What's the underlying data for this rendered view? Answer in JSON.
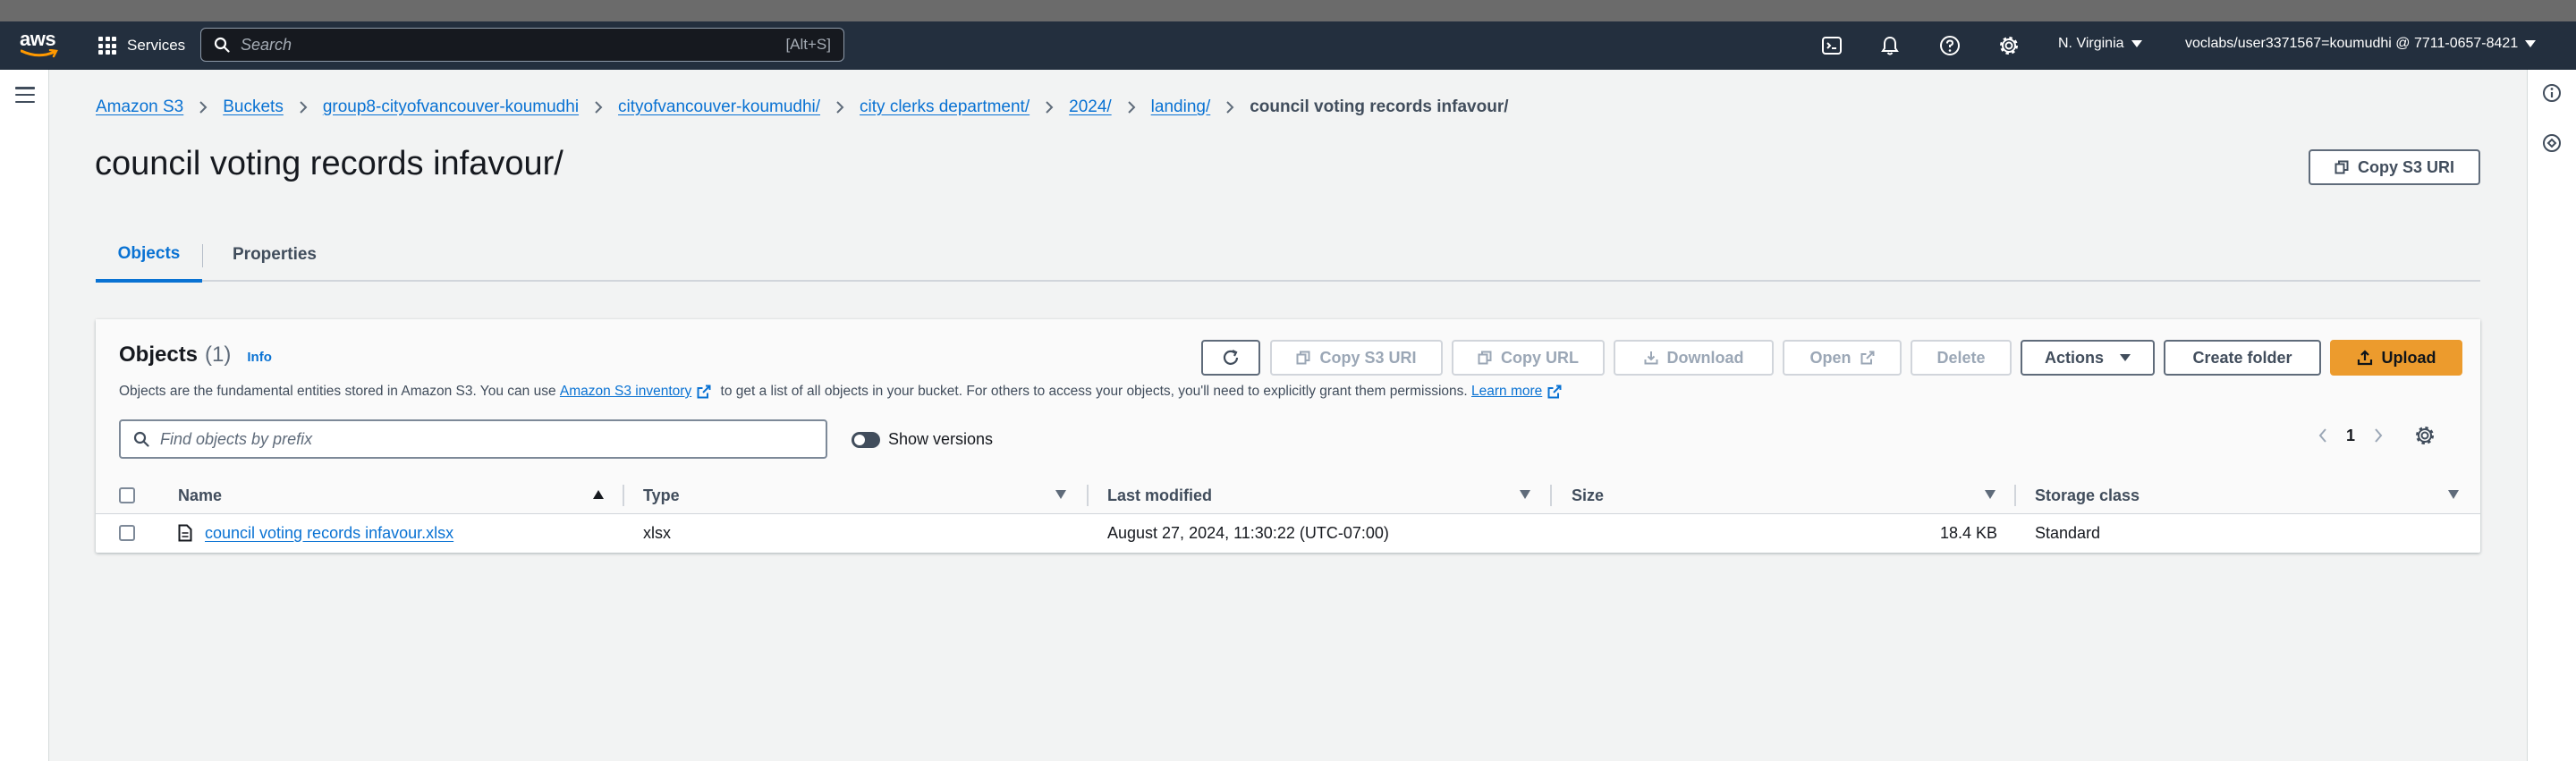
{
  "topnav": {
    "logo": "aws",
    "services_label": "Services",
    "search_placeholder": "Search",
    "search_shortcut": "[Alt+S]",
    "region": "N. Virginia",
    "account": "voclabs/user3371567=koumudhi @ 7711-0657-8421",
    "icons": [
      "cloudshell-icon",
      "bell-icon",
      "help-icon",
      "settings-icon"
    ]
  },
  "breadcrumbs": {
    "items": [
      "Amazon S3",
      "Buckets",
      "group8-cityofvancouver-koumudhi",
      "cityofvancouver-koumudhi/",
      "city clerks department/",
      "2024/",
      "landing/"
    ],
    "current": "council voting records infavour/"
  },
  "page": {
    "title": "council voting records infavour/",
    "copy_uri_label": "Copy S3 URI"
  },
  "tabs": [
    "Objects",
    "Properties"
  ],
  "objects_panel": {
    "title": "Objects",
    "count": "(1)",
    "info": "Info",
    "desc_before": "Objects are the fundamental entities stored in Amazon S3. You can use ",
    "desc_link": "Amazon S3 inventory",
    "desc_after": " to get a list of all objects in your bucket. For others to access your objects, you'll need to explicitly grant them permissions. ",
    "learn_more": "Learn more",
    "buttons": {
      "copy_s3_uri": "Copy S3 URI",
      "copy_url": "Copy URL",
      "download": "Download",
      "open": "Open",
      "delete": "Delete",
      "actions": "Actions",
      "create_folder": "Create folder",
      "upload": "Upload"
    },
    "filter_placeholder": "Find objects by prefix",
    "show_versions": "Show versions",
    "page_number": "1"
  },
  "table": {
    "columns": [
      "Name",
      "Type",
      "Last modified",
      "Size",
      "Storage class"
    ],
    "rows": [
      {
        "name": "council voting records infavour.xlsx",
        "type": "xlsx",
        "last_modified": "August 27, 2024, 11:30:22 (UTC-07:00)",
        "size": "18.4 KB",
        "storage_class": "Standard"
      }
    ]
  },
  "colors": {
    "nav_bg": "#232f3e",
    "link": "#0972d3",
    "primary": "#ec9b2d",
    "page_bg": "#f2f3f3"
  }
}
